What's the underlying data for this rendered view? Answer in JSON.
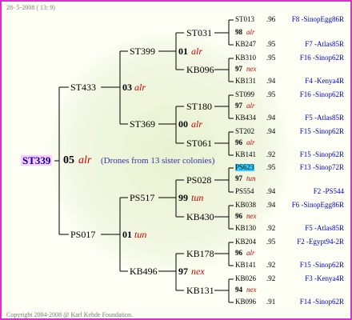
{
  "date_stamp": "28- 5-2008 ( 13: 9)",
  "copyright": "Copyright 2004-2008 @ Karl Kehde Foundation.",
  "root": {
    "id": "ST339",
    "score": "05",
    "gene": "alr",
    "note": "(Drones from 13 sister colonies)"
  },
  "level1": [
    {
      "id": "ST433",
      "score": "03",
      "gene": "alr"
    },
    {
      "id": "PS017",
      "score": "01",
      "gene": "tun"
    }
  ],
  "level2": [
    {
      "id": "ST399",
      "score": "01",
      "gene": "alr"
    },
    {
      "id": "ST369",
      "score": "00",
      "gene": "alr"
    },
    {
      "id": "PS517",
      "score": "99",
      "gene": "tun"
    },
    {
      "id": "KB496",
      "score": "97",
      "gene": "nex"
    }
  ],
  "level3": [
    {
      "id": "ST031"
    },
    {
      "id": "KB096"
    },
    {
      "id": "ST180"
    },
    {
      "id": "ST061"
    },
    {
      "id": "PS028"
    },
    {
      "id": "KB430"
    },
    {
      "id": "KB178"
    },
    {
      "id": "KB131"
    }
  ],
  "level4": [
    {
      "id": "ST013",
      "pct": ".96",
      "origin": "F8 -SinopEgg86R"
    },
    {
      "score": "98",
      "gene": "alr"
    },
    {
      "id": "KB247",
      "pct": ".95",
      "origin": "F7 -Atlas85R"
    },
    {
      "id": "KB310",
      "pct": ".95",
      "origin": "F16 -Sinop62R"
    },
    {
      "score": "97",
      "gene": "nex"
    },
    {
      "id": "KB131",
      "pct": ".94",
      "origin": "F4 -Kenya4R"
    },
    {
      "id": "ST099",
      "pct": ".95",
      "origin": "F16 -Sinop62R"
    },
    {
      "score": "97",
      "gene": "alr"
    },
    {
      "id": "KB434",
      "pct": ".94",
      "origin": "F5 -Atlas85R"
    },
    {
      "id": "ST202",
      "pct": ".94",
      "origin": "F15 -Sinop62R"
    },
    {
      "score": "96",
      "gene": "alr"
    },
    {
      "id": "KB141",
      "pct": ".92",
      "origin": "F15 -Sinop62R"
    },
    {
      "id": "PS623",
      "pct": ".95",
      "origin": "F13 -Sinop72R"
    },
    {
      "score": "97",
      "gene": "tun"
    },
    {
      "id": "PS554",
      "pct": ".94",
      "origin": "F2 -PS544"
    },
    {
      "id": "KB038",
      "pct": ".94",
      "origin": "F6 -SinopEgg86R"
    },
    {
      "score": "96",
      "gene": "nex"
    },
    {
      "id": "KB130",
      "pct": ".92",
      "origin": "F5 -Atlas85R"
    },
    {
      "id": "KB204",
      "pct": ".95",
      "origin": "F2 -Egypt94-2R"
    },
    {
      "score": "96",
      "gene": "alr"
    },
    {
      "id": "KB141",
      "pct": ".92",
      "origin": "F15 -Sinop62R"
    },
    {
      "id": "KB026",
      "pct": ".92",
      "origin": "F3 -Kenya4R"
    },
    {
      "score": "94",
      "gene": "nex"
    },
    {
      "id": "KB096",
      "pct": ".91",
      "origin": "F14 -Sinop62R"
    }
  ],
  "colors": {
    "frame": "#d633cc",
    "root_highlight": "#ffccff",
    "gene_text": "#cc0000",
    "origin_text": "#0000cc",
    "selected_highlight": "#33ccff"
  }
}
